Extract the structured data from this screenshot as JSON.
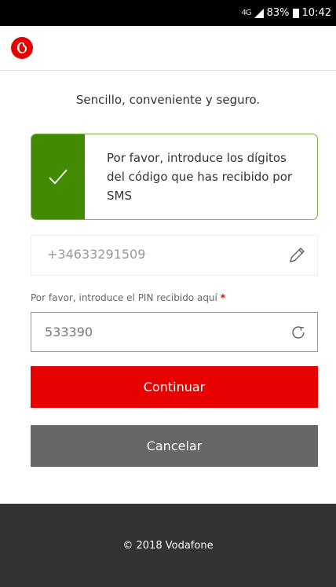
{
  "status_bar": {
    "network": "4G",
    "battery": "83%",
    "time": "10:42"
  },
  "brand": {
    "logo_icon": "vodafone-logo",
    "color": "#e60000"
  },
  "tagline": "Sencillo, conveniente y seguro.",
  "notice": {
    "icon": "checkmark-icon",
    "message": "Por favor, introduce los dígitos del código que has recibido por SMS",
    "accent": "#428b00"
  },
  "phone": {
    "value": "+34633291509",
    "edit_icon": "pencil-icon"
  },
  "pin": {
    "label": "Por favor, introduce el PIN recibido aquí",
    "required_mark": "*",
    "value": "533390",
    "refresh_icon": "refresh-icon"
  },
  "buttons": {
    "continue_label": "Continuar",
    "cancel_label": "Cancelar"
  },
  "footer": {
    "copyright": "© 2018 Vodafone"
  }
}
